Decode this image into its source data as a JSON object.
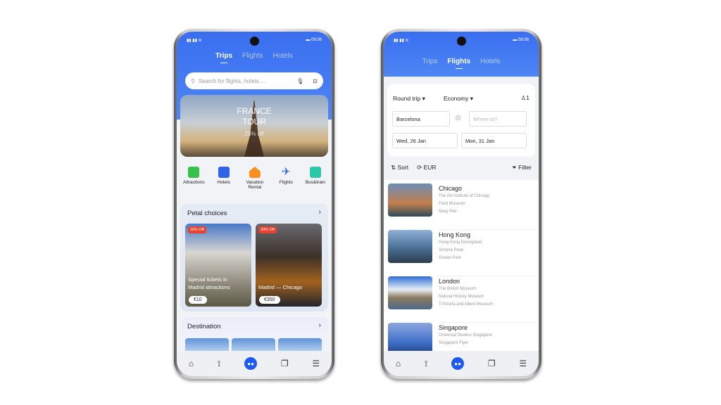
{
  "status": {
    "time": "08:08"
  },
  "left": {
    "tabs": [
      "Trips",
      "Flights",
      "Hotels"
    ],
    "active_tab": "Trips",
    "search": {
      "placeholder": "Search for flights, hotels ..."
    },
    "hero": {
      "title1": "FRANCE",
      "title2": "TOUR",
      "subtitle": "25% off"
    },
    "quick": [
      {
        "label": "Attractions",
        "color": "#36c24a"
      },
      {
        "label": "Hotels",
        "color": "#2f63ea"
      },
      {
        "label": "Vacation Rental",
        "color": "#f7901e"
      },
      {
        "label": "Flights",
        "color": "#2f63ea"
      },
      {
        "label": "Bus&train",
        "color": "#2cc7a8"
      }
    ],
    "petal": {
      "title": "Petal choices",
      "items": [
        {
          "badge": "20% Off",
          "line1": "Special tickets in",
          "line2": "Madrid attractions",
          "price": "€10"
        },
        {
          "badge": "20% Off",
          "line1": "",
          "line2": "Madrid — Chicago",
          "price": "€350"
        }
      ]
    },
    "destination": {
      "title": "Destination"
    }
  },
  "right": {
    "tabs": [
      "Trips",
      "Flights",
      "Hotels"
    ],
    "active_tab": "Flights",
    "trip_type": "Round trip",
    "cabin": "Economy",
    "passengers": "1",
    "from": "Barcelona",
    "to_placeholder": "Where to?",
    "depart": "Wed, 26 Jan",
    "return": "Mon, 31 Jan",
    "sort": "Sort",
    "currency": "EUR",
    "filter": "Filter",
    "destinations": [
      {
        "name": "Chicago",
        "spots": [
          "The Art Institute of Chicago",
          "Field Museum",
          "Navy Pier"
        ]
      },
      {
        "name": "Hong Kong",
        "spots": [
          "Hong Kong Disneyland",
          "Victoria Peak",
          "Ocean Park"
        ]
      },
      {
        "name": "London",
        "spots": [
          "The British Museum",
          "Natural History Museum",
          "TVictoria and Albert Museum"
        ]
      },
      {
        "name": "Singapore",
        "spots": [
          "Universal Studios Singapore",
          "Singapore Flyer"
        ]
      }
    ]
  },
  "colors": {
    "accent": "#3a6ef0",
    "badge": "#e8412e"
  }
}
